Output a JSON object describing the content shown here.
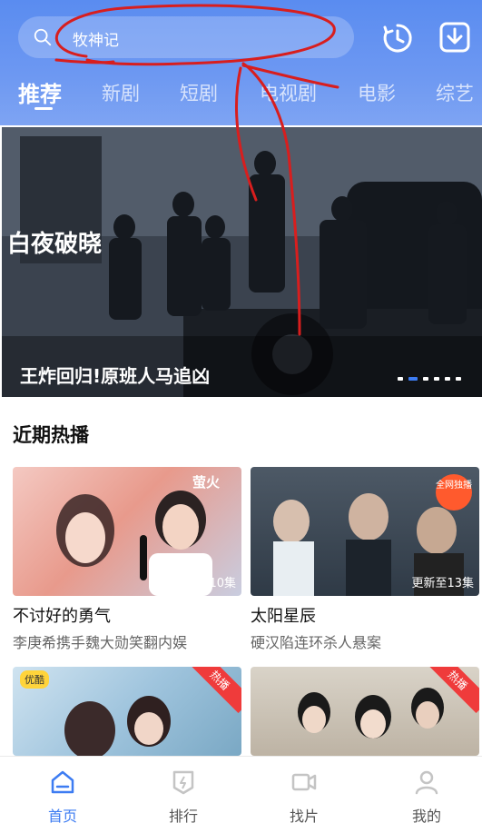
{
  "header": {
    "search_text": "牧神记",
    "tabs": [
      "推荐",
      "新剧",
      "短剧",
      "电视剧",
      "电影",
      "综艺"
    ],
    "active_tab": 0
  },
  "banner": {
    "logo_text": "白夜破晓",
    "title": "王炸回归!原班人马追凶",
    "dot_count": 6,
    "active_dot": 1
  },
  "section": {
    "title": "近期热播"
  },
  "cards": [
    {
      "title": "不讨好的勇气",
      "subtitle": "李庚希携手魏大勋笑翻内娱",
      "badge": "更新至10集",
      "corner_text": "萤火"
    },
    {
      "title": "太阳星辰",
      "subtitle": "硬汉陷连环杀人悬案",
      "badge": "更新至13集",
      "round_tag": "全网独播"
    },
    {
      "title": "",
      "subtitle": "",
      "badge": "",
      "corner_text": "热播",
      "brand_text": "优酷"
    },
    {
      "title": "",
      "subtitle": "",
      "badge": "",
      "corner_text": "热播"
    }
  ],
  "bottom_nav": [
    {
      "label": "首页",
      "icon": "home-icon",
      "active": true
    },
    {
      "label": "排行",
      "icon": "rank-icon",
      "active": false
    },
    {
      "label": "找片",
      "icon": "video-camera-icon",
      "active": false
    },
    {
      "label": "我的",
      "icon": "user-icon",
      "active": false
    }
  ],
  "colors": {
    "accent": "#3d7cf2",
    "header_top": "#5a8cf0",
    "annotation": "#d81e1e",
    "hot_corner": "#ef3b3b"
  }
}
